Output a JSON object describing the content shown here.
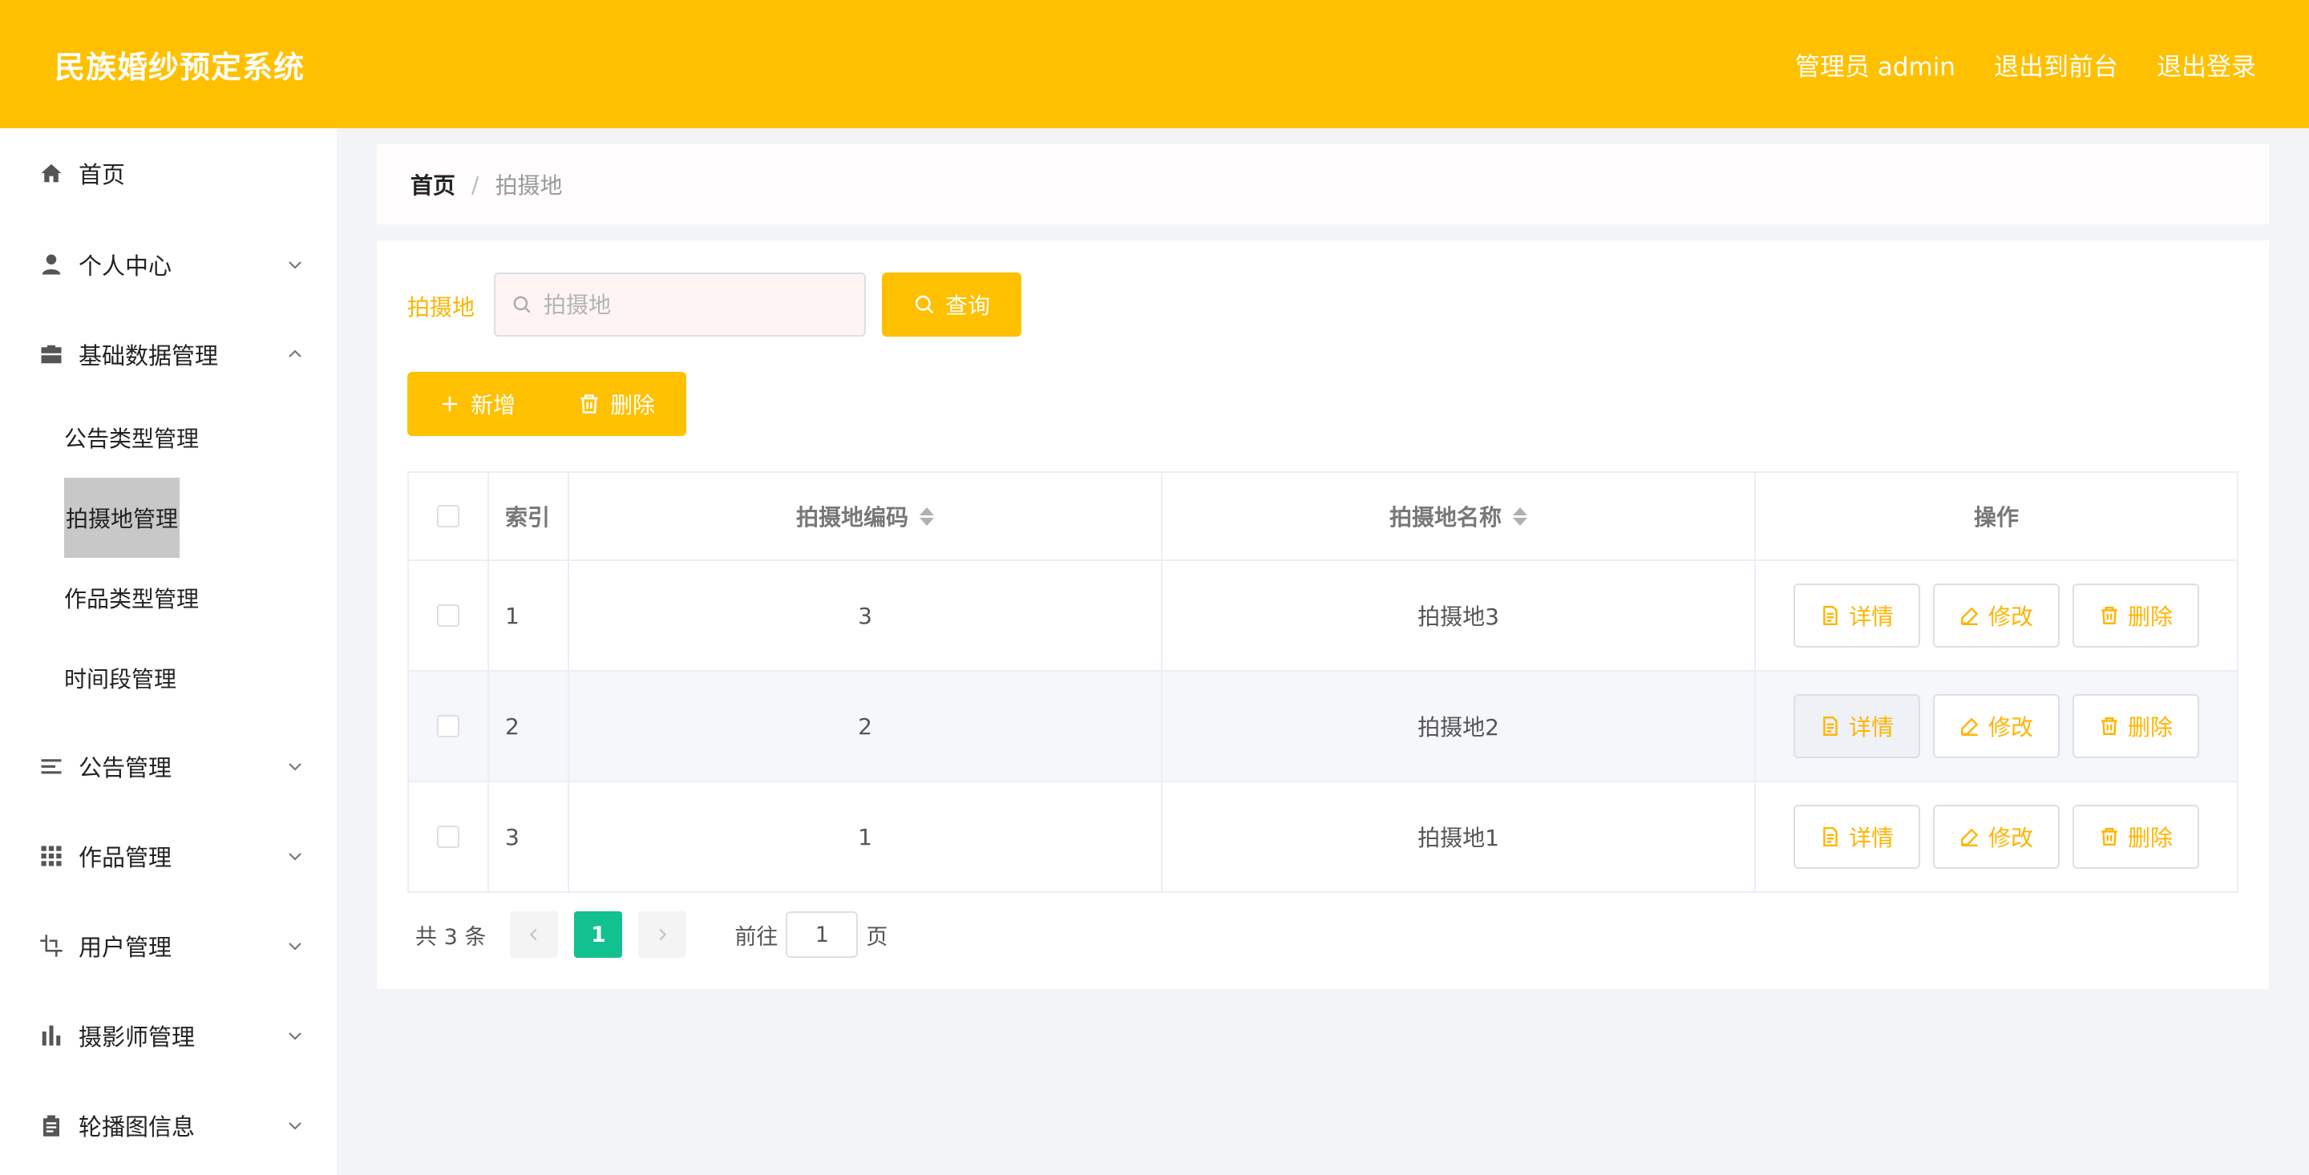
{
  "header": {
    "title": "民族婚纱预定系统",
    "user_label": "管理员 admin",
    "to_frontend": "退出到前台",
    "logout": "退出登录",
    "brand_color": "#ffc000"
  },
  "sidebar": {
    "items": [
      {
        "label": "首页",
        "icon": "home-icon"
      },
      {
        "label": "个人中心",
        "icon": "user-icon"
      },
      {
        "label": "基础数据管理",
        "icon": "briefcase-icon",
        "expanded": true
      },
      {
        "label": "公告管理",
        "icon": "list-icon"
      },
      {
        "label": "作品管理",
        "icon": "grid-icon"
      },
      {
        "label": "用户管理",
        "icon": "crop-icon"
      },
      {
        "label": "摄影师管理",
        "icon": "bar-chart-icon"
      },
      {
        "label": "轮播图信息",
        "icon": "clipboard-icon"
      }
    ],
    "subitems": [
      {
        "label": "公告类型管理"
      },
      {
        "label": "拍摄地管理",
        "active": true
      },
      {
        "label": "作品类型管理"
      },
      {
        "label": "时间段管理"
      }
    ]
  },
  "breadcrumb": {
    "home": "首页",
    "separator": "/",
    "current": "拍摄地"
  },
  "search": {
    "label": "拍摄地",
    "placeholder": "拍摄地",
    "query_button": "查询"
  },
  "actions": {
    "add": "新增",
    "delete": "删除"
  },
  "table": {
    "columns": [
      "索引",
      "拍摄地编码",
      "拍摄地名称",
      "操作"
    ],
    "rows": [
      {
        "index": "1",
        "code": "3",
        "name": "拍摄地3"
      },
      {
        "index": "2",
        "code": "2",
        "name": "拍摄地2"
      },
      {
        "index": "3",
        "code": "1",
        "name": "拍摄地1"
      }
    ],
    "op_labels": {
      "detail": "详情",
      "edit": "修改",
      "delete": "删除"
    }
  },
  "pagination": {
    "total": "共 3 条",
    "current_page": "1",
    "goto_label": "前往",
    "goto_value": "1",
    "page_suffix": "页",
    "active_color": "#13c08f"
  }
}
